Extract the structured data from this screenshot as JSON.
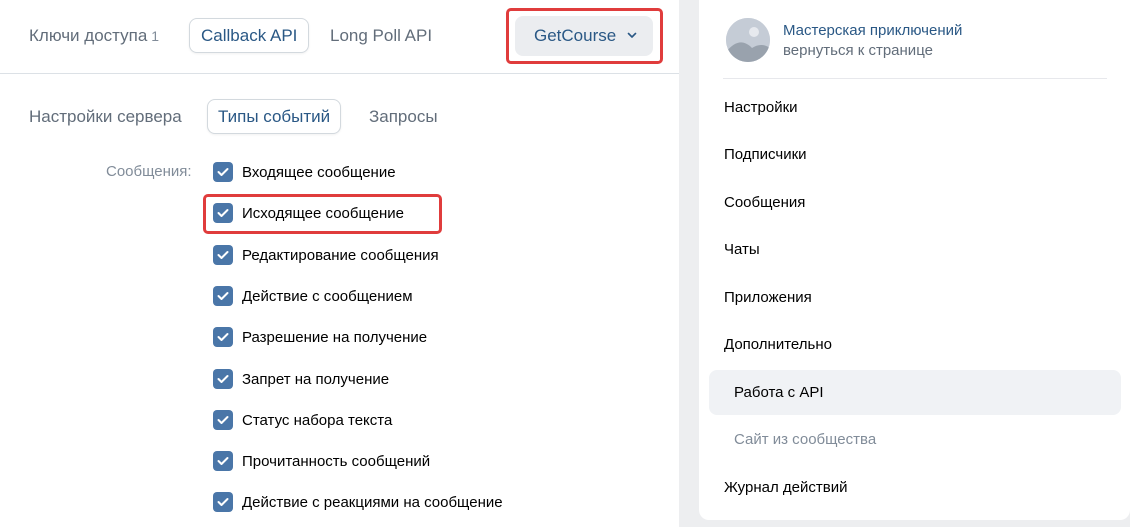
{
  "top_tabs": {
    "keys": {
      "label": "Ключи доступа",
      "count": "1"
    },
    "callback": "Callback API",
    "longpoll": "Long Poll API"
  },
  "server_dropdown": {
    "label": "GetCourse",
    "icon": "chevron-down-icon"
  },
  "sub_tabs": {
    "server_settings": "Настройки сервера",
    "event_types": "Типы событий",
    "requests": "Запросы"
  },
  "events": {
    "section_label": "Сообщения:",
    "items": [
      {
        "label": "Входящее сообщение",
        "checked": true
      },
      {
        "label": "Исходящее сообщение",
        "checked": true
      },
      {
        "label": "Редактирование сообщения",
        "checked": true
      },
      {
        "label": "Действие с сообщением",
        "checked": true
      },
      {
        "label": "Разрешение на получение",
        "checked": true
      },
      {
        "label": "Запрет на получение",
        "checked": true
      },
      {
        "label": "Статус набора текста",
        "checked": true
      },
      {
        "label": "Прочитанность сообщений",
        "checked": true
      },
      {
        "label": "Действие с реакциями на сообщение",
        "checked": true
      }
    ]
  },
  "sidebar": {
    "group_name": "Мастерская приключений",
    "back_link": "вернуться к странице",
    "menu": [
      "Настройки",
      "Подписчики",
      "Сообщения",
      "Чаты",
      "Приложения",
      "Дополнительно",
      "Работа с API",
      "Сайт из сообщества",
      "Журнал действий"
    ]
  },
  "colors": {
    "accent": "#2a5885",
    "checkbox": "#4a76a8",
    "highlight": "#e03c3c",
    "background": "#edeef0"
  }
}
